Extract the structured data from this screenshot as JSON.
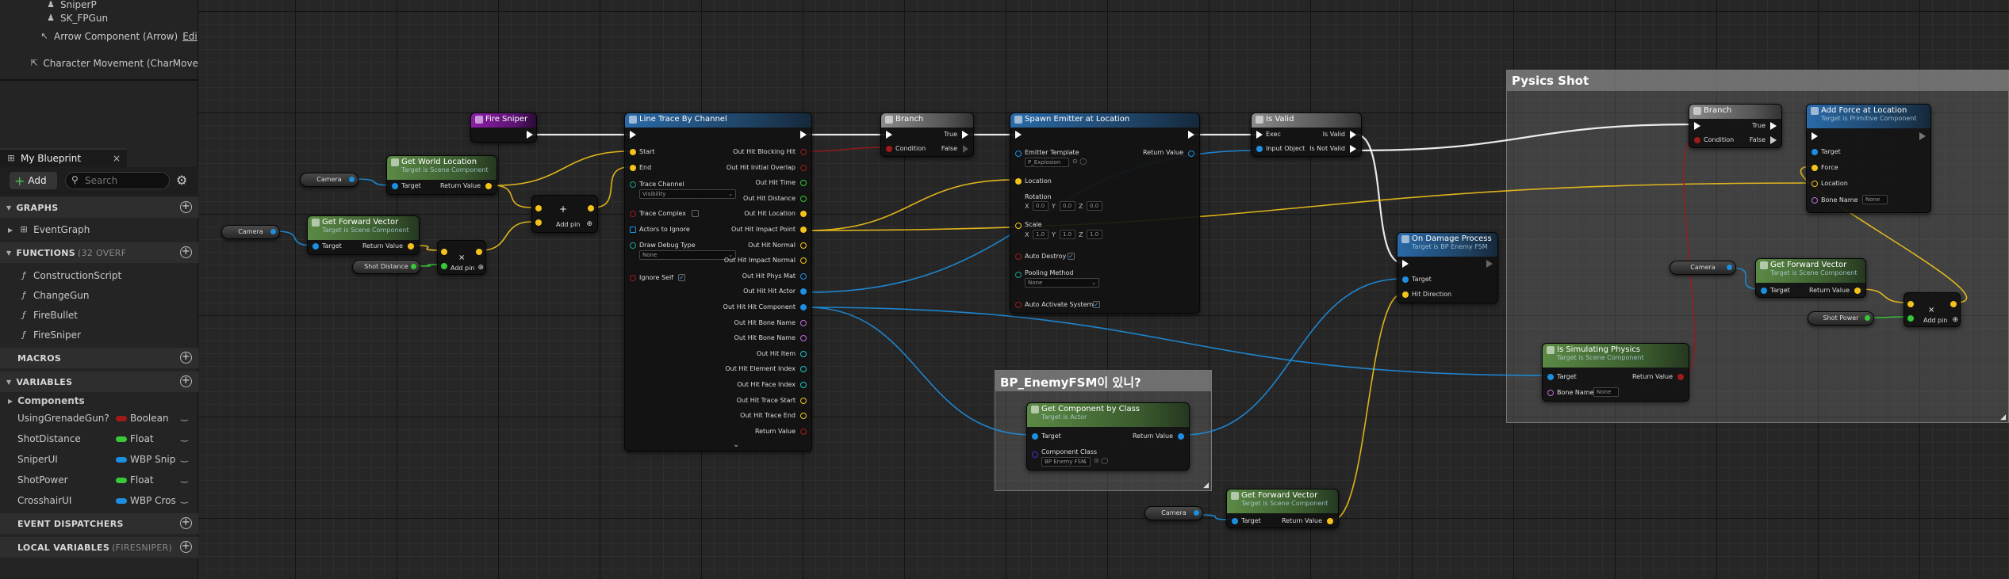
{
  "components_panel": {
    "items": [
      {
        "label": "SniperP",
        "icon": "skeletal-mesh-icon"
      },
      {
        "label": "SK_FPGun",
        "icon": "skeletal-mesh-icon"
      },
      {
        "label": "Arrow Component (Arrow)",
        "edit": "Edi",
        "icon": "arrow-icon"
      },
      {
        "label": "Character Movement (CharMove",
        "icon": "movement-icon"
      }
    ]
  },
  "my_blueprint": {
    "title": "My Blueprint",
    "add_label": "Add",
    "search_placeholder": "Search",
    "sections": {
      "graphs": "GRAPHS",
      "functions": "FUNCTIONS",
      "functions_count": "(32 OVERF",
      "macros": "MACROS",
      "variables": "VARIABLES",
      "components": "Components",
      "event_dispatchers": "EVENT DISPATCHERS",
      "local_variables": "LOCAL VARIABLES",
      "local_variables_sub": "(FIRESNIPER)"
    },
    "graphs": [
      "EventGraph"
    ],
    "functions": [
      "ConstructionScript",
      "ChangeGun",
      "FireBullet",
      "FireSniper"
    ],
    "variables": [
      {
        "name": "UsingGrenadeGun?",
        "type": "Boolean",
        "color": "#a11a1a"
      },
      {
        "name": "ShotDistance",
        "type": "Float",
        "color": "#38c838"
      },
      {
        "name": "SniperUI",
        "type": "WBP Snip",
        "color": "#1d8fe0"
      },
      {
        "name": "ShotPower",
        "type": "Float",
        "color": "#38c838"
      },
      {
        "name": "CrosshairUI",
        "type": "WBP Cros",
        "color": "#1d8fe0"
      }
    ]
  },
  "graph": {
    "comments": {
      "physics_shot": "Pysics Shot",
      "enemy_fsm": "BP_EnemyFSM이 있니?"
    },
    "nodes": {
      "fire_sniper": {
        "title": "Fire Sniper"
      },
      "get_world_location": {
        "title": "Get World Location",
        "subtitle": "Target is Scene Component",
        "target": "Target",
        "return": "Return Value"
      },
      "get_forward_vector_1": {
        "title": "Get Forward Vector",
        "subtitle": "Target is Scene Component",
        "target": "Target",
        "return": "Return Value"
      },
      "camera_1": "Camera",
      "camera_2": "Camera",
      "camera_3": "Camera",
      "camera_4": "Camera",
      "shot_distance": "Shot Distance",
      "shot_power": "Shot Power",
      "add_pin": "Add pin",
      "line_trace": {
        "title": "Line Trace By Channel",
        "inputs": {
          "start": "Start",
          "end": "End",
          "trace_channel": "Trace Channel",
          "trace_channel_value": "Visibility",
          "trace_complex": "Trace Complex",
          "actors_to_ignore": "Actors to Ignore",
          "draw_debug_type": "Draw Debug Type",
          "draw_debug_value": "None",
          "ignore_self": "Ignore Self"
        },
        "outputs": [
          "Out Hit Blocking Hit",
          "Out Hit Initial Overlap",
          "Out Hit Time",
          "Out Hit Distance",
          "Out Hit Location",
          "Out Hit Impact Point",
          "Out Hit Normal",
          "Out Hit Impact Normal",
          "Out Hit Phys Mat",
          "Out Hit Hit Actor",
          "Out Hit Hit Component",
          "Out Hit Bone Name",
          "Out Hit Bone Name",
          "Out Hit Item",
          "Out Hit Element Index",
          "Out Hit Face Index",
          "Out Hit Trace Start",
          "Out Hit Trace End",
          "Return Value"
        ]
      },
      "branch_1": {
        "title": "Branch",
        "condition": "Condition",
        "true": "True",
        "false": "False"
      },
      "spawn_emitter": {
        "title": "Spawn Emitter at Location",
        "emitter_template": "Emitter Template",
        "emitter_value": "P_Explosion",
        "return": "Return Value",
        "location": "Location",
        "rotation": "Rotation",
        "scale": "Scale",
        "rot_x": "0.0",
        "rot_y": "0.0",
        "rot_z": "0.0",
        "scale_x": "1.0",
        "scale_y": "1.0",
        "scale_z": "1.0",
        "auto_destroy": "Auto Destroy",
        "pooling_method": "Pooling Method",
        "pooling_value": "None",
        "auto_activate": "Auto Activate System"
      },
      "is_valid": {
        "title": "Is Valid",
        "exec": "Exec",
        "is_valid": "Is Valid",
        "input_object": "Input Object",
        "is_not_valid": "Is Not Valid"
      },
      "get_component_by_class": {
        "title": "Get Component by Class",
        "subtitle": "Target is Actor",
        "target": "Target",
        "return": "Return Value",
        "component_class": "Component Class",
        "class_value": "BP Enemy FSM"
      },
      "on_damage_process": {
        "title": "On Damage Process",
        "subtitle": "Target is BP Enemy FSM",
        "target": "Target",
        "hit_direction": "Hit Direction"
      },
      "get_forward_vector_2": {
        "title": "Get Forward Vector",
        "subtitle": "Target is Scene Component",
        "target": "Target",
        "return": "Return Value"
      },
      "branch_2": {
        "title": "Branch",
        "condition": "Condition",
        "true": "True",
        "false": "False"
      },
      "add_force": {
        "title": "Add Force at Location",
        "subtitle": "Target is Primitive Component",
        "target": "Target",
        "force": "Force",
        "location": "Location",
        "bone_name": "Bone Name",
        "bone_value": "None"
      },
      "get_forward_vector_3": {
        "title": "Get Forward Vector",
        "subtitle": "Target is Scene Component",
        "target": "Target",
        "return": "Return Value"
      },
      "is_simulating_physics": {
        "title": "Is Simulating Physics",
        "subtitle": "Target is Scene Component",
        "target": "Target",
        "return": "Return Value",
        "bone_name": "Bone Name",
        "bone_value": "None"
      }
    }
  },
  "colors": {
    "exec": "#ffffff",
    "vector": "#f3c31b",
    "object": "#1d8fe0",
    "float": "#38c838",
    "bool": "#a11a1a",
    "struct": "#1e5fa0"
  }
}
